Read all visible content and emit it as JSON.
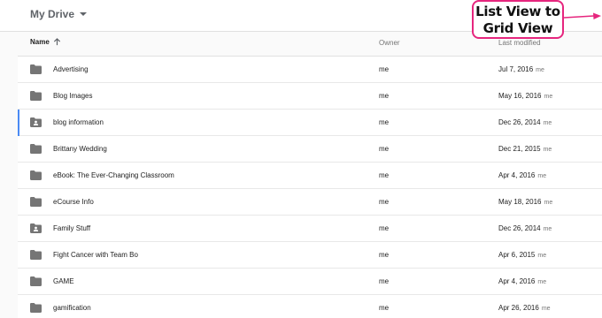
{
  "header": {
    "title": "My Drive"
  },
  "columns": {
    "name": "Name",
    "owner": "Owner",
    "modified": "Last modified"
  },
  "files": [
    {
      "name": "Advertising",
      "type": "folder",
      "owner": "me",
      "date": "Jul 7, 2016",
      "by": "me"
    },
    {
      "name": "Blog Images",
      "type": "folder",
      "owner": "me",
      "date": "May 16, 2016",
      "by": "me"
    },
    {
      "name": "blog information",
      "type": "shared-folder",
      "owner": "me",
      "date": "Dec 26, 2014",
      "by": "me"
    },
    {
      "name": "Brittany Wedding",
      "type": "folder",
      "owner": "me",
      "date": "Dec 21, 2015",
      "by": "me"
    },
    {
      "name": "eBook: The Ever-Changing Classroom",
      "type": "folder",
      "owner": "me",
      "date": "Apr 4, 2016",
      "by": "me"
    },
    {
      "name": "eCourse Info",
      "type": "folder",
      "owner": "me",
      "date": "May 18, 2016",
      "by": "me"
    },
    {
      "name": "Family Stuff",
      "type": "shared-folder",
      "owner": "me",
      "date": "Dec 26, 2014",
      "by": "me"
    },
    {
      "name": "Fight Cancer with Team Bo",
      "type": "folder",
      "owner": "me",
      "date": "Apr 6, 2015",
      "by": "me"
    },
    {
      "name": "GAME",
      "type": "folder",
      "owner": "me",
      "date": "Apr 4, 2016",
      "by": "me"
    },
    {
      "name": "gamification",
      "type": "folder",
      "owner": "me",
      "date": "Apr 26, 2016",
      "by": "me"
    }
  ],
  "callout": {
    "line1": "List View to",
    "line2": "Grid View"
  },
  "colors": {
    "accent": "#e6267e",
    "selection": "#4a8af4",
    "folder": "#757575"
  }
}
